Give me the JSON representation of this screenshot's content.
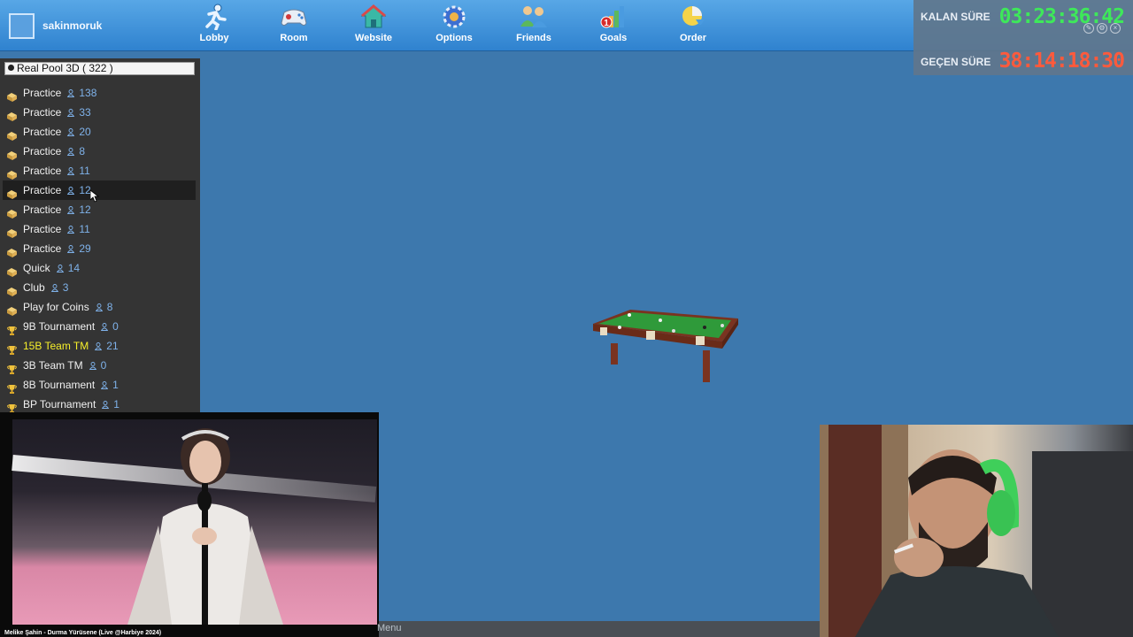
{
  "toolbar": {
    "username": "sakinmoruk",
    "nav": [
      {
        "label": "Lobby",
        "icon": "runner-icon"
      },
      {
        "label": "Room",
        "icon": "gamepad-icon"
      },
      {
        "label": "Website",
        "icon": "house-icon"
      },
      {
        "label": "Options",
        "icon": "gear-icon"
      },
      {
        "label": "Friends",
        "icon": "friends-icon"
      },
      {
        "label": "Goals",
        "icon": "goals-chart-icon",
        "badge": "1"
      },
      {
        "label": "Order",
        "icon": "order-chart-icon"
      }
    ]
  },
  "timer": {
    "remaining_label": "KALAN SÜRE",
    "remaining_value": "03:23:36:42",
    "elapsed_label": "GEÇEN SÜRE",
    "elapsed_value": "38:14:18:30",
    "remaining_color": "#3ee85a",
    "elapsed_color": "#ff5a3c"
  },
  "sidebar": {
    "header": "Real Pool 3D  ( 322 )",
    "rooms": [
      {
        "name": "Practice",
        "count": "138",
        "type": "box-icon"
      },
      {
        "name": "Practice",
        "count": "33",
        "type": "box-icon"
      },
      {
        "name": "Practice",
        "count": "20",
        "type": "box-icon"
      },
      {
        "name": "Practice",
        "count": "8",
        "type": "box-icon"
      },
      {
        "name": "Practice",
        "count": "11",
        "type": "box-icon"
      },
      {
        "name": "Practice",
        "count": "12",
        "type": "box-icon",
        "selected": true
      },
      {
        "name": "Practice",
        "count": "12",
        "type": "box-icon"
      },
      {
        "name": "Practice",
        "count": "11",
        "type": "box-icon"
      },
      {
        "name": "Practice",
        "count": "29",
        "type": "box-icon"
      },
      {
        "name": "Quick",
        "count": "14",
        "type": "box-icon"
      },
      {
        "name": "Club",
        "count": "3",
        "type": "box-icon"
      },
      {
        "name": "Play for Coins",
        "count": "8",
        "type": "box-icon"
      },
      {
        "name": "9B Tournament",
        "count": "0",
        "type": "trophy-icon"
      },
      {
        "name": "15B Team TM",
        "count": "21",
        "type": "trophy-icon",
        "highlight": true
      },
      {
        "name": "3B Team TM",
        "count": "0",
        "type": "trophy-icon"
      },
      {
        "name": "8B Tournament",
        "count": "1",
        "type": "trophy-icon"
      },
      {
        "name": "BP Tournament",
        "count": "1",
        "type": "trophy-icon"
      }
    ]
  },
  "video": {
    "caption": "Melike Şahin - Durma Yürüsene (Live @Harbiye 2024)"
  },
  "bottom": {
    "menu_label": "Menu"
  },
  "colors": {
    "background": "#3d78ad",
    "toolbar": "#3a8fd9",
    "sidebar": "#343434",
    "count_text": "#7fb2ea",
    "highlight_text": "#f6ef2a"
  }
}
